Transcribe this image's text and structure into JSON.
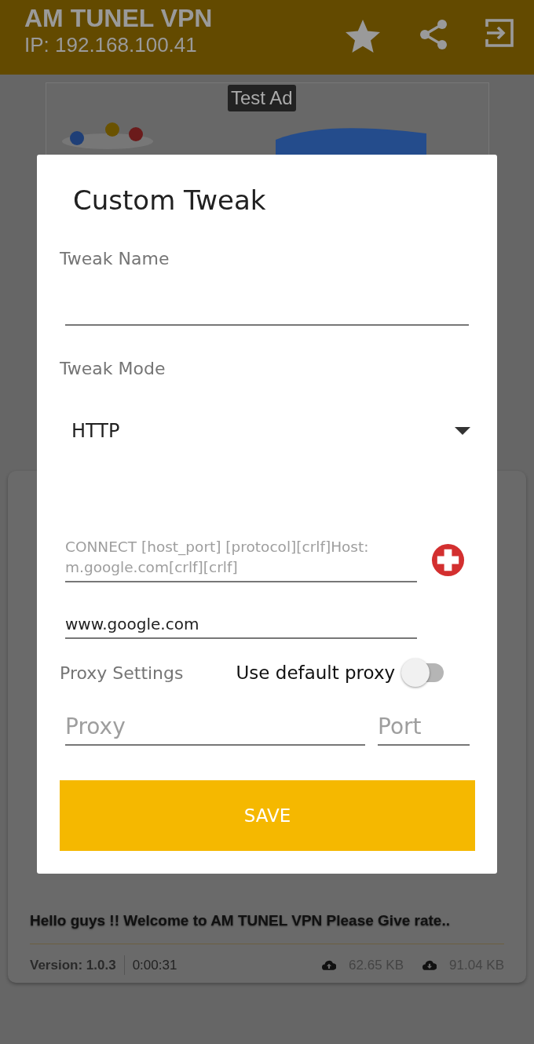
{
  "app_bar": {
    "title": "AM TUNEL VPN",
    "subtitle": "IP: 192.168.100.41"
  },
  "ad": {
    "label": "Test Ad"
  },
  "dialog": {
    "title": "Custom Tweak",
    "tweak_name": {
      "label": "Tweak Name"
    },
    "tweak_mode": {
      "label": "Tweak Mode",
      "value": "HTTP"
    },
    "payload": {
      "placeholder": "CONNECT [host_port] [protocol][crlf]Host: m.google.com[crlf][crlf]"
    },
    "host": {
      "value": "www.google.com"
    },
    "proxy_settings": {
      "label": "Proxy Settings",
      "toggle_label": "Use default proxy",
      "on": false
    },
    "proxy": {
      "placeholder": "Proxy"
    },
    "port": {
      "placeholder": "Port"
    },
    "save_button": "SAVE"
  },
  "status_card": {
    "message": "Hello guys !! Welcome to AM TUNEL VPN Please Give rate..",
    "version": "Version: 1.0.3",
    "duration": "0:00:31",
    "upload": "62.65 KB",
    "download": "91.04 KB"
  }
}
